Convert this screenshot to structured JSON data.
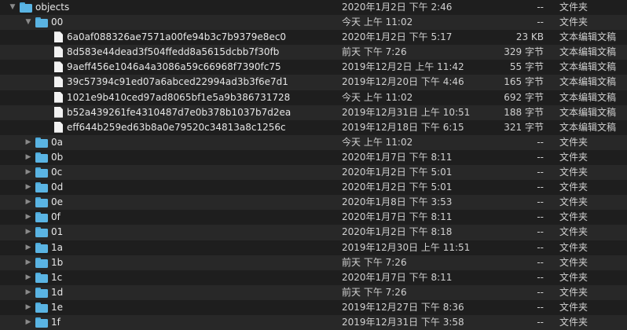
{
  "rows": [
    {
      "depth": 0,
      "type": "folder",
      "expanded": true,
      "name": "objects",
      "date": "2020年1月2日 下午 2:46",
      "size": "--",
      "kind": "文件夹"
    },
    {
      "depth": 1,
      "type": "folder",
      "expanded": true,
      "name": "00",
      "date": "今天 上午 11:02",
      "size": "--",
      "kind": "文件夹"
    },
    {
      "depth": 2,
      "type": "file",
      "name": "6a0af088326ae7571a00fe94b3c7b9379e8ec0",
      "date": "2020年1月2日 下午 5:17",
      "size": "23 KB",
      "kind": "文本编辑文稿"
    },
    {
      "depth": 2,
      "type": "file",
      "name": "8d583e44dead3f504ffedd8a5615dcbb7f30fb",
      "date": "前天 下午 7:26",
      "size": "329 字节",
      "kind": "文本编辑文稿"
    },
    {
      "depth": 2,
      "type": "file",
      "name": "9aeff456e1046a4a3086a59c66968f7390fc75",
      "date": "2019年12月2日 上午 11:42",
      "size": "55 字节",
      "kind": "文本编辑文稿"
    },
    {
      "depth": 2,
      "type": "file",
      "name": "39c57394c91ed07a6abced22994ad3b3f6e7d1",
      "date": "2019年12月20日 下午 4:46",
      "size": "165 字节",
      "kind": "文本编辑文稿"
    },
    {
      "depth": 2,
      "type": "file",
      "name": "1021e9b410ced97ad8065bf1e5a9b386731728",
      "date": "今天 上午 11:02",
      "size": "692 字节",
      "kind": "文本编辑文稿"
    },
    {
      "depth": 2,
      "type": "file",
      "name": "b52a439261fe4310487d7e0b378b1037b7d2ea",
      "date": "2019年12月31日 上午 10:51",
      "size": "188 字节",
      "kind": "文本编辑文稿"
    },
    {
      "depth": 2,
      "type": "file",
      "name": "eff644b259ed63b8a0e79520c34813a8c1256c",
      "date": "2019年12月18日 下午 6:15",
      "size": "321 字节",
      "kind": "文本编辑文稿"
    },
    {
      "depth": 1,
      "type": "folder",
      "expanded": false,
      "name": "0a",
      "date": "今天 上午 11:02",
      "size": "--",
      "kind": "文件夹"
    },
    {
      "depth": 1,
      "type": "folder",
      "expanded": false,
      "name": "0b",
      "date": "2020年1月7日 下午 8:11",
      "size": "--",
      "kind": "文件夹"
    },
    {
      "depth": 1,
      "type": "folder",
      "expanded": false,
      "name": "0c",
      "date": "2020年1月2日 下午 5:01",
      "size": "--",
      "kind": "文件夹"
    },
    {
      "depth": 1,
      "type": "folder",
      "expanded": false,
      "name": "0d",
      "date": "2020年1月2日 下午 5:01",
      "size": "--",
      "kind": "文件夹"
    },
    {
      "depth": 1,
      "type": "folder",
      "expanded": false,
      "name": "0e",
      "date": "2020年1月8日 下午 3:53",
      "size": "--",
      "kind": "文件夹"
    },
    {
      "depth": 1,
      "type": "folder",
      "expanded": false,
      "name": "0f",
      "date": "2020年1月7日 下午 8:11",
      "size": "--",
      "kind": "文件夹"
    },
    {
      "depth": 1,
      "type": "folder",
      "expanded": false,
      "name": "01",
      "date": "2020年1月2日 下午 8:18",
      "size": "--",
      "kind": "文件夹"
    },
    {
      "depth": 1,
      "type": "folder",
      "expanded": false,
      "name": "1a",
      "date": "2019年12月30日 上午 11:51",
      "size": "--",
      "kind": "文件夹"
    },
    {
      "depth": 1,
      "type": "folder",
      "expanded": false,
      "name": "1b",
      "date": "前天 下午 7:26",
      "size": "--",
      "kind": "文件夹"
    },
    {
      "depth": 1,
      "type": "folder",
      "expanded": false,
      "name": "1c",
      "date": "2020年1月7日 下午 8:11",
      "size": "--",
      "kind": "文件夹"
    },
    {
      "depth": 1,
      "type": "folder",
      "expanded": false,
      "name": "1d",
      "date": "前天 下午 7:26",
      "size": "--",
      "kind": "文件夹"
    },
    {
      "depth": 1,
      "type": "folder",
      "expanded": false,
      "name": "1e",
      "date": "2019年12月27日 下午 8:36",
      "size": "--",
      "kind": "文件夹"
    },
    {
      "depth": 1,
      "type": "folder",
      "expanded": false,
      "name": "1f",
      "date": "2019年12月31日 下午 3:58",
      "size": "--",
      "kind": "文件夹"
    }
  ]
}
